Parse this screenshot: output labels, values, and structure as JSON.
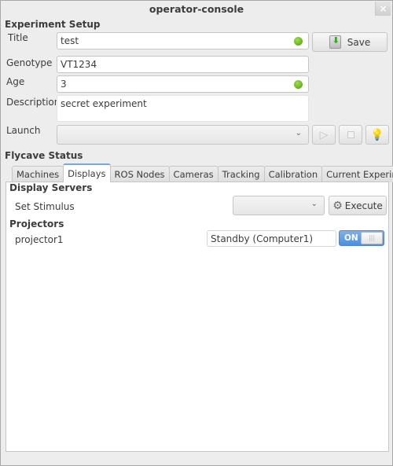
{
  "window": {
    "title": "operator-console",
    "close_label": "×"
  },
  "experiment_setup": {
    "heading": "Experiment Setup",
    "title_label": "Title",
    "title_value": "test",
    "genotype_label": "Genotype",
    "genotype_value": "VT1234",
    "age_label": "Age",
    "age_value": "3",
    "description_label": "Description",
    "description_value": "secret experiment",
    "launch_label": "Launch",
    "launch_value": "",
    "save_label": "Save",
    "status_color": "#5fb01a"
  },
  "flycave_status": {
    "heading": "Flycave Status",
    "tabs": [
      {
        "label": "Machines"
      },
      {
        "label": "Displays"
      },
      {
        "label": "ROS Nodes"
      },
      {
        "label": "Cameras"
      },
      {
        "label": "Tracking"
      },
      {
        "label": "Calibration"
      },
      {
        "label": "Current Experiment"
      }
    ],
    "active_tab": "Displays",
    "display_servers": {
      "heading": "Display Servers",
      "set_stimulus_label": "Set Stimulus",
      "stimulus_value": "",
      "execute_label": "Execute"
    },
    "projectors": {
      "heading": "Projectors",
      "items": [
        {
          "name": "projector1",
          "status": "Standby (Computer1)",
          "toggle_label": "ON",
          "toggle_on": true
        }
      ]
    }
  }
}
